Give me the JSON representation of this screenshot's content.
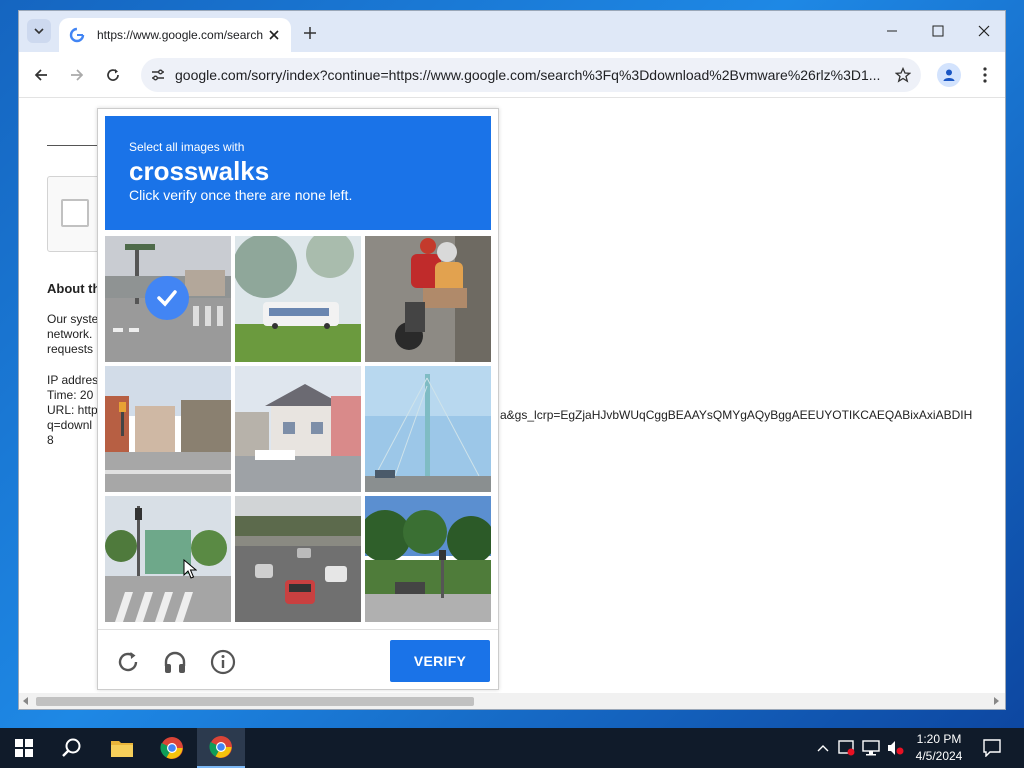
{
  "browser": {
    "tab_title": "https://www.google.com/search",
    "url": "google.com/sorry/index?continue=https://www.google.com/search%3Fq%3Ddownload%2Bvmware%26rlz%3D1..."
  },
  "page": {
    "about_heading": "About th",
    "text_lines": [
      "Our syste",
      "network.",
      "requests"
    ],
    "ip_line": "IP addres",
    "time_line": "Time: 20",
    "url_line": "URL: http",
    "q_line": "q=downl",
    "num_line": "8",
    "url_tail": "a&gs_lcrp=EgZjaHJvbWUqCggBEAAYsQMYgAQyBggAEEUYOTIKCAEQABixAxiABDIH"
  },
  "captcha": {
    "instruction_line1": "Select all images with",
    "keyword": "crosswalks",
    "instruction_line3": "Click verify once there are none left.",
    "verify_label": "VERIFY",
    "accent": "#1a73e8",
    "tiles": [
      {
        "scene": "street-intersection",
        "selected": true
      },
      {
        "scene": "bus-on-grass",
        "selected": false
      },
      {
        "scene": "motorcycle-riders",
        "selected": false
      },
      {
        "scene": "city-street-corner",
        "selected": false
      },
      {
        "scene": "suburban-houses",
        "selected": false
      },
      {
        "scene": "bridge-tower",
        "selected": false
      },
      {
        "scene": "crosswalk-traffic-light",
        "selected": false
      },
      {
        "scene": "highway-cars",
        "selected": false
      },
      {
        "scene": "park-traffic-light",
        "selected": false
      }
    ]
  },
  "taskbar": {
    "time": "1:20 PM",
    "date": "4/5/2024"
  }
}
